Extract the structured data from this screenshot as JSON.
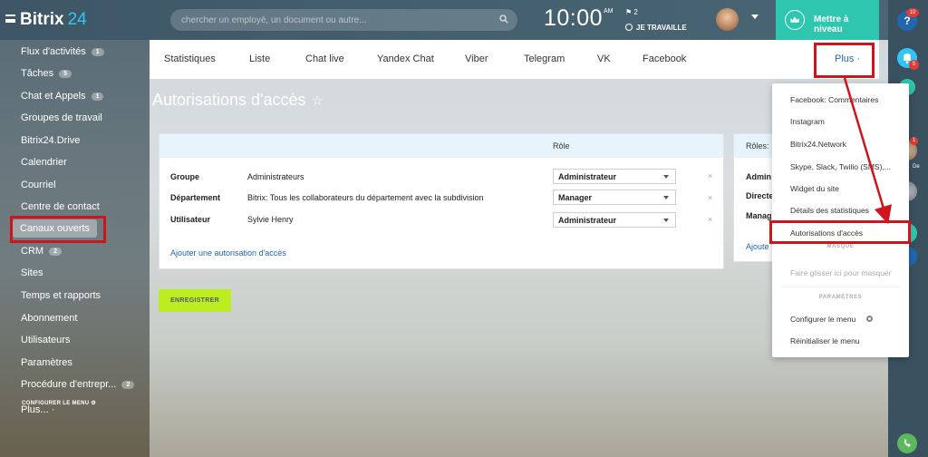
{
  "app": {
    "name": "Bitrix",
    "version": "24"
  },
  "search": {
    "placeholder": "chercher un employé, un document ou autre..."
  },
  "clock": {
    "time": "10:00",
    "ampm": "AM",
    "flag_count": "2",
    "status": "JE TRAVAILLE"
  },
  "upgrade": {
    "label": "Mettre à niveau"
  },
  "sidebar": {
    "items": [
      {
        "label": "Flux d'activités",
        "badge": "1"
      },
      {
        "label": "Tâches",
        "badge": "5"
      },
      {
        "label": "Chat et Appels",
        "badge": "1"
      },
      {
        "label": "Groupes de travail"
      },
      {
        "label": "Bitrix24.Drive"
      },
      {
        "label": "Calendrier"
      },
      {
        "label": "Courriel"
      },
      {
        "label": "Centre de contact"
      },
      {
        "label": "Canaux ouverts"
      },
      {
        "label": "CRM",
        "badge": "2"
      },
      {
        "label": "Sites"
      },
      {
        "label": "Temps et rapports"
      },
      {
        "label": "Abonnement"
      },
      {
        "label": "Utilisateurs"
      },
      {
        "label": "Paramètres"
      },
      {
        "label": "Procédure d'entrepr...",
        "badge": "2"
      },
      {
        "label": "Plus... ·"
      }
    ],
    "config_label": "CONFIGURER LE MENU"
  },
  "tabs": [
    "Statistiques",
    "Liste",
    "Chat live",
    "Yandex Chat",
    "Viber",
    "Telegram",
    "VK",
    "Facebook",
    "Plus ·"
  ],
  "page": {
    "title": "Autorisations d'accès",
    "star": "☆"
  },
  "permissions": {
    "column_header": "Rôle",
    "rows": [
      {
        "type": "Groupe",
        "subject": "Administrateurs",
        "role": "Administrateur"
      },
      {
        "type": "Département",
        "subject": "Bitrix: Tous les collaborateurs du département avec la subdivision",
        "role": "Manager"
      },
      {
        "type": "Utilisateur",
        "subject": "Sylvie Henry",
        "role": "Administrateur"
      }
    ],
    "remove_glyph": "×",
    "add_link": "Ajouter une autorisation d'accès"
  },
  "roles_panel": {
    "header": "Rôles:",
    "items": [
      "Admin",
      "Directe",
      "Manag"
    ],
    "link": "Ajoute"
  },
  "save_button": "ENREGISTRER",
  "dropdown": {
    "items": [
      "Facebook: Commentaires",
      "Instagram",
      "Bitrix24.Network",
      "Skype, Slack, Twilio (SMS),...",
      "Widget du site",
      "Détails des statistiques",
      "Autorisations d'accès"
    ],
    "hidden_section": "MASQUE",
    "drag_hint": "Faire glisser ici pour masquer",
    "settings_section": "PARAMÈTRES",
    "configure": "Configurer le menu",
    "reset": "Réinitialiser le menu"
  },
  "right_rail": {
    "help_badge": "10",
    "notifications_badge": "5",
    "contact_badge": "1",
    "contact_label": "De"
  },
  "colors": {
    "accent": "#2fc6f6",
    "highlight": "#d0141c",
    "save_button": "#bbed21",
    "link": "#2067b0",
    "upgrade": "#2fc6b0"
  }
}
